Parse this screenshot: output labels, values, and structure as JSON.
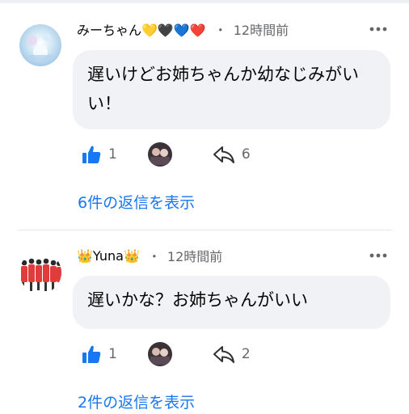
{
  "comments": [
    {
      "author": "みーちゃん💛🖤💙❤️",
      "separator": "・",
      "time": "12時間前",
      "text": "遅いけどお姉ちゃんか幼なじみがいい！",
      "likes": "1",
      "replies": "6",
      "view_replies": "6件の返信を表示"
    },
    {
      "author": "👑Yuna👑",
      "separator": "・",
      "time": "12時間前",
      "text": "遅いかな？お姉ちゃんがいい",
      "likes": "1",
      "replies": "2",
      "view_replies": "2件の返信を表示"
    }
  ],
  "colors": {
    "accent": "#1877f2",
    "muted": "#65676b",
    "bubble": "#f0f2f5"
  },
  "icons": {
    "like": "thumbs-up-icon",
    "reply": "reply-arrow-icon",
    "more": "more-dots-icon"
  }
}
